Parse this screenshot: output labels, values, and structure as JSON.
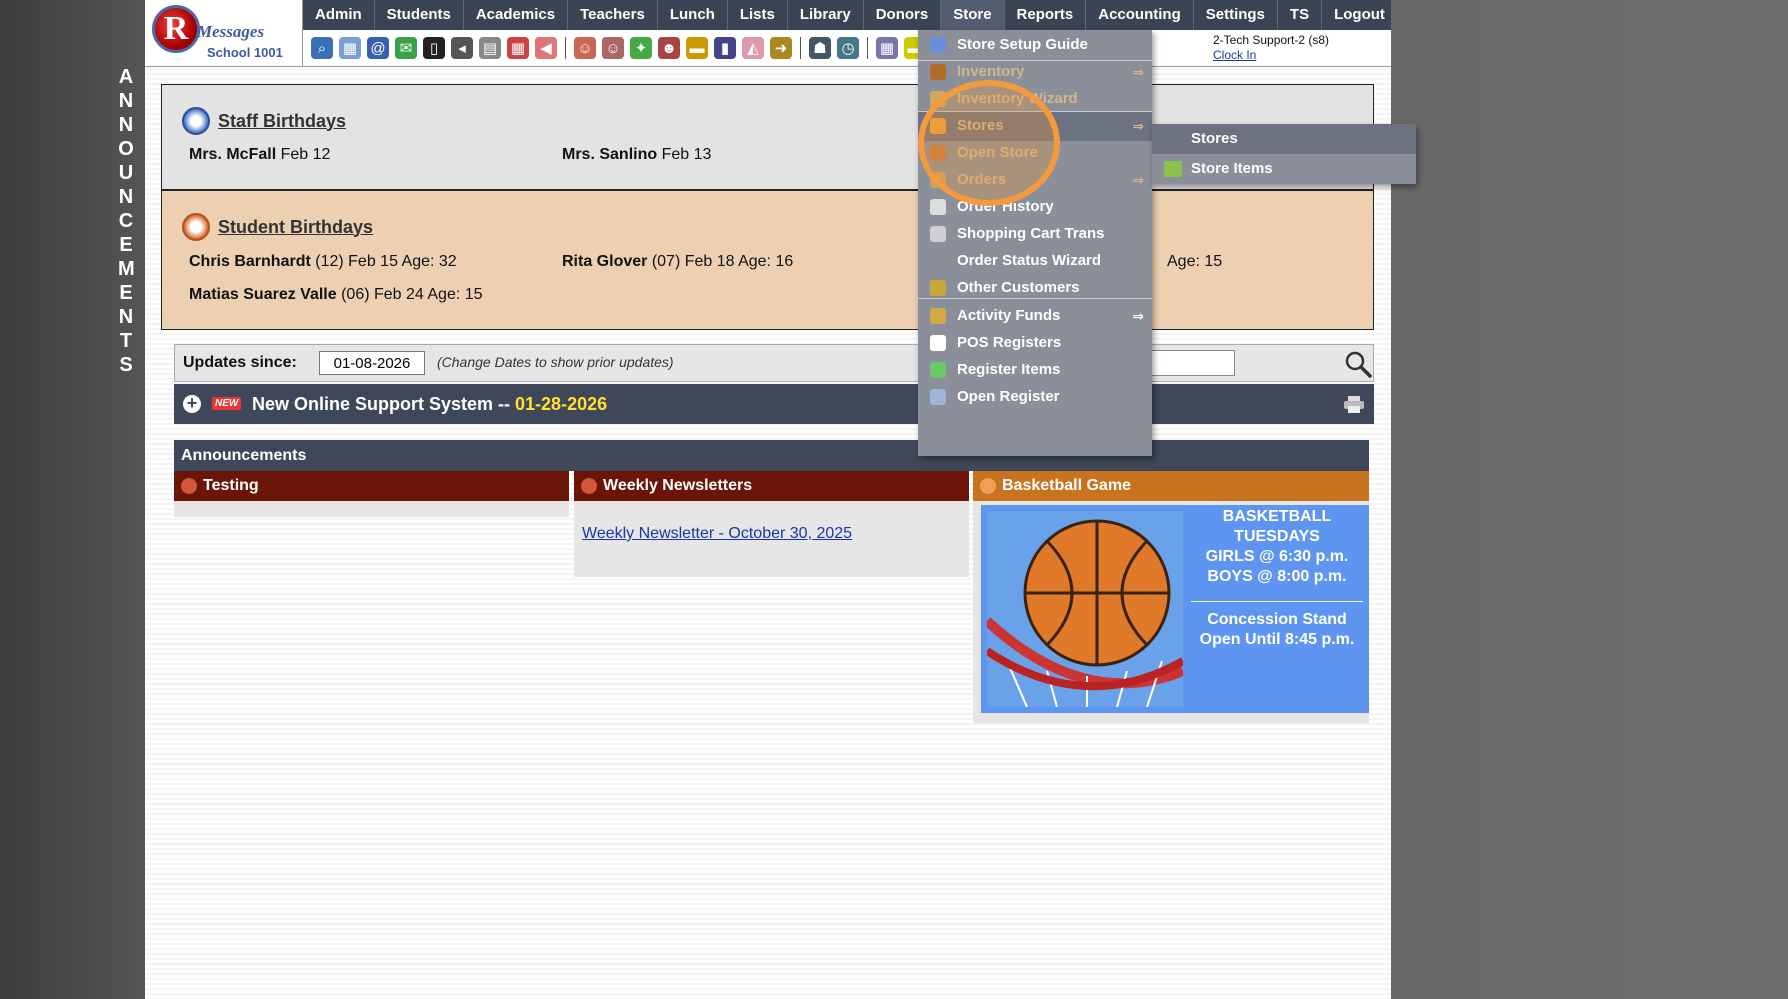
{
  "logo": {
    "brand": "Messages",
    "school": "School 1001"
  },
  "nav": {
    "items": [
      "Admin",
      "Students",
      "Academics",
      "Teachers",
      "Lunch",
      "Lists",
      "Library",
      "Donors",
      "Store",
      "Reports",
      "Accounting",
      "Settings",
      "TS",
      "Logout"
    ],
    "active": "Store"
  },
  "toolbar": {
    "icons": [
      "search-icon",
      "calendar-grid-icon",
      "email-icon",
      "chat-icon",
      "phone-icon",
      "speaker-icon",
      "report-icon",
      "calendar-icon",
      "megaphone-icon",
      "user-add-icon",
      "user-icon",
      "ticket-icon",
      "group-icon",
      "lunch-icon",
      "book-icon",
      "bell-icon",
      "export-icon",
      "staff-icon",
      "clock-icon",
      "table-icon",
      "list-icon"
    ]
  },
  "user": {
    "name": "2-Tech Support-2 (s8)",
    "clock_in": "Clock In"
  },
  "sidebar": {
    "vertical_label": "ANNOUNCEMENTS"
  },
  "staff_birthdays": {
    "title": "Staff Birthdays",
    "entries": [
      {
        "name": "Mrs. McFall",
        "date": "Feb 12"
      },
      {
        "name": "Mrs. Sanlino",
        "date": "Feb 13"
      }
    ]
  },
  "student_birthdays": {
    "title": "Student Birthdays",
    "entries": [
      {
        "name": "Chris Barnhardt",
        "detail": "(12) Feb 15 Age: 32"
      },
      {
        "name": "Rita Glover",
        "detail": "(07) Feb 18 Age: 16"
      },
      {
        "name": "Matias Suarez Valle",
        "detail": "(06) Feb 24 Age: 15"
      }
    ],
    "partial_hidden": "Age: 15"
  },
  "updates": {
    "label": "Updates since:",
    "date_value": "01-08-2026",
    "hint": "(Change Dates to show prior updates)"
  },
  "news": {
    "badge": "NEW",
    "text": "New Online Support System -- ",
    "date": "01-28-2026"
  },
  "announcements": {
    "header": "Announcements",
    "columns": [
      {
        "title": "Testing"
      },
      {
        "title": "Weekly Newsletters",
        "link": "Weekly Newsletter - October 30, 2025"
      },
      {
        "title": "Basketball Game",
        "lines": [
          "BASKETBALL",
          "TUESDAYS",
          "GIRLS @ 6:30 p.m.",
          "BOYS  @ 8:00 p.m."
        ],
        "lines2": [
          "Concession Stand",
          "Open Until 8:45 p.m."
        ]
      }
    ]
  },
  "store_menu": {
    "items": [
      {
        "label": "Store Setup Guide",
        "icon": "info-icon"
      },
      {
        "label": "Inventory",
        "icon": "inventory-icon",
        "submenu": true
      },
      {
        "label": "Inventory Wizard",
        "icon": "wizard-icon"
      },
      {
        "label": "Stores",
        "icon": "store-icon",
        "submenu": true
      },
      {
        "label": "Open Store",
        "icon": "open-store-icon"
      },
      {
        "label": "Orders",
        "icon": "orders-icon",
        "submenu": true
      },
      {
        "label": "Order History",
        "icon": "history-icon"
      },
      {
        "label": "Shopping Cart Trans",
        "icon": "cart-icon"
      },
      {
        "label": "Order Status Wizard",
        "icon": ""
      },
      {
        "label": "Other Customers",
        "icon": "customer-icon"
      },
      {
        "label": "Activity Funds",
        "icon": "funds-icon",
        "submenu": true
      },
      {
        "label": "POS Registers",
        "icon": "register-icon"
      },
      {
        "label": "Register Items",
        "icon": "register-items-icon"
      },
      {
        "label": "Open Register",
        "icon": "open-register-icon"
      }
    ],
    "arrow": "⇒"
  },
  "stores_submenu": {
    "items": [
      {
        "label": "Stores"
      },
      {
        "label": "Store Items"
      }
    ]
  },
  "colors": {
    "nav_bg": "#3b4454",
    "menu_bg": "#8a8f99",
    "highlight_ring": "#f39a3c",
    "news_date": "#ffe033"
  }
}
